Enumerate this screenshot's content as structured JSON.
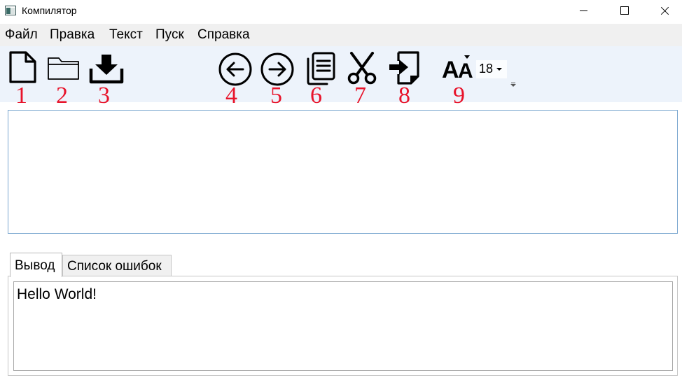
{
  "window": {
    "title": "Компилятор",
    "icon": "app-window-icon"
  },
  "menu": [
    "Файл",
    "Правка",
    "Текст",
    "Пуск",
    "Справка"
  ],
  "toolbar": {
    "tools": [
      {
        "icon": "new-file-icon",
        "number": "1"
      },
      {
        "icon": "open-folder-icon",
        "number": "2"
      },
      {
        "icon": "save-download-icon",
        "number": "3"
      },
      {
        "icon": "undo-arrow-left-icon",
        "number": "4"
      },
      {
        "icon": "redo-arrow-right-icon",
        "number": "5"
      },
      {
        "icon": "copy-icon",
        "number": "6"
      },
      {
        "icon": "cut-scissors-icon",
        "number": "7"
      },
      {
        "icon": "paste-import-icon",
        "number": "8"
      },
      {
        "icon": "font-size-icon",
        "number": "9"
      }
    ],
    "font_size_value": "18"
  },
  "editor": {
    "value": ""
  },
  "tabs": [
    {
      "label": "Вывод",
      "active": true
    },
    {
      "label": "Список ошибок",
      "active": false
    }
  ],
  "output": {
    "text": "Hello World!"
  },
  "colors": {
    "toolbar_bg": "#edf3fb",
    "menu_bg": "#f0f0f0",
    "annotation_red": "#e8142b",
    "editor_border": "#7aa7cf"
  }
}
